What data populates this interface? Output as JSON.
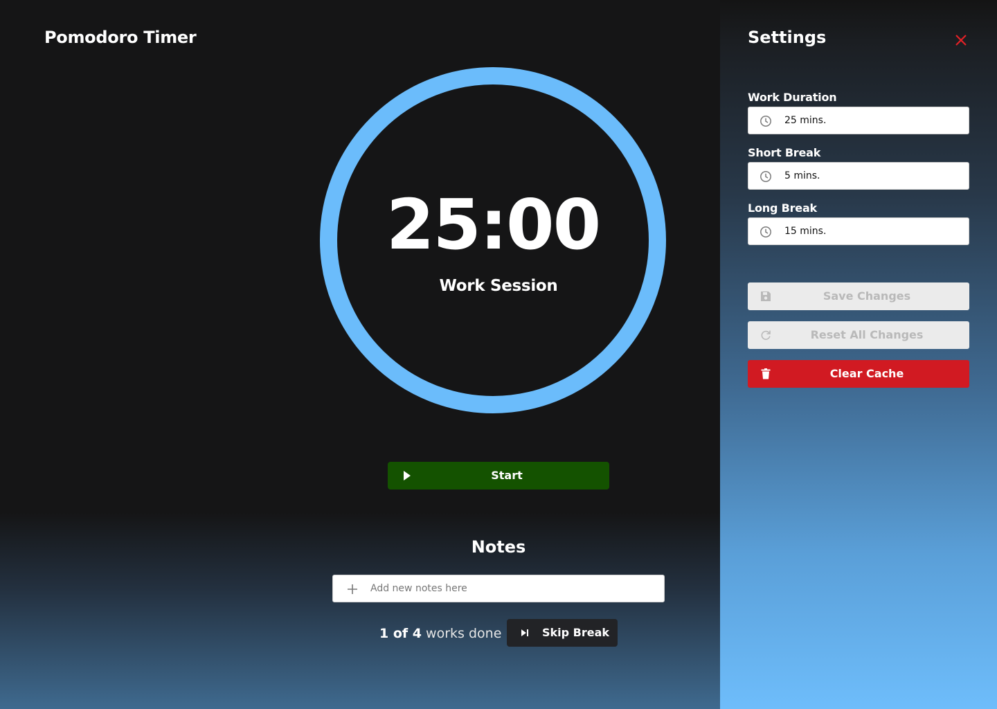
{
  "app": {
    "title": "Pomodoro Timer"
  },
  "timer": {
    "time": "25:00",
    "session_label": "Work Session",
    "ring_color": "#6bbcfb",
    "progress_fraction": 1.0
  },
  "controls": {
    "start_label": "Start",
    "start_color": "#145200",
    "start_icon": "play-icon"
  },
  "notes": {
    "title": "Notes",
    "input_placeholder": "Add new notes here",
    "add_icon": "plus-icon"
  },
  "progress": {
    "done_count": "1 of 4",
    "suffix": "works done",
    "skip_label": "Skip Break",
    "skip_icon": "skip-forward-icon"
  },
  "settings": {
    "title": "Settings",
    "close_icon": "close-icon",
    "close_color": "#e52126",
    "fields": [
      {
        "label": "Work Duration",
        "value": "25 mins.",
        "icon": "clock-icon"
      },
      {
        "label": "Short Break",
        "value": "5 mins.",
        "icon": "clock-icon"
      },
      {
        "label": "Long Break",
        "value": "15 mins.",
        "icon": "clock-icon"
      }
    ],
    "buttons": {
      "save_label": "Save Changes",
      "save_icon": "save-icon",
      "reset_label": "Reset All Changes",
      "reset_icon": "refresh-icon",
      "clear_label": "Clear Cache",
      "clear_icon": "trash-icon",
      "clear_color": "#d11a22"
    }
  }
}
